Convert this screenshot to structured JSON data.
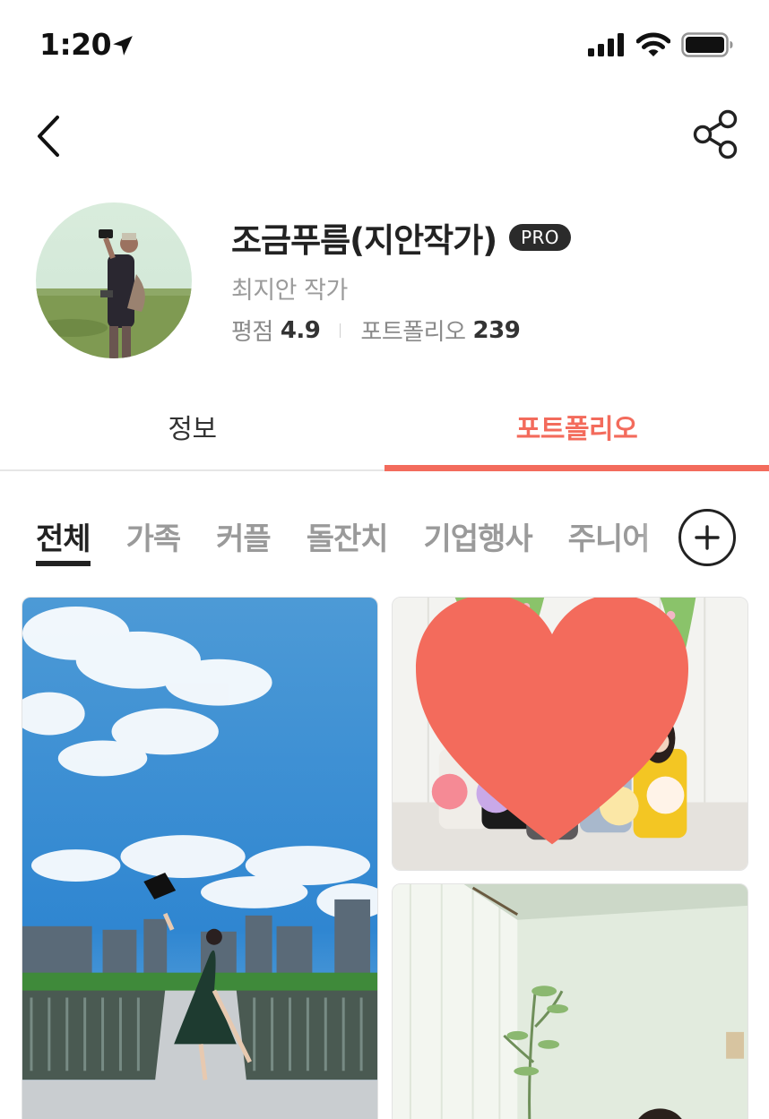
{
  "status_bar": {
    "time": "1:20",
    "icons": [
      "location-arrow-icon",
      "signal-icon",
      "wifi-icon",
      "battery-icon"
    ]
  },
  "nav": {
    "back_icon": "chevron-left-icon",
    "share_icon": "share-icon"
  },
  "profile": {
    "name": "조금푸름(지안작가)",
    "badge": "PRO",
    "real_name": "최지안 작가",
    "rating_label": "평점",
    "rating_value": "4.9",
    "portfolio_label": "포트폴리오",
    "portfolio_count": "239"
  },
  "tabs": [
    {
      "label": "정보",
      "active": false
    },
    {
      "label": "포트폴리오",
      "active": true
    }
  ],
  "categories": [
    "전체",
    "가족",
    "커플",
    "돌잔치",
    "기업행사",
    "주니어"
  ],
  "active_category": "전체",
  "add_category_icon": "plus-circle-icon",
  "photos": [
    {
      "liked": false
    },
    {
      "liked": true
    },
    {
      "liked": false
    }
  ],
  "colors": {
    "accent": "#f36b5c",
    "text_primary": "#222222",
    "text_muted": "#9a9a9a",
    "badge_bg": "#2b2b2b"
  }
}
